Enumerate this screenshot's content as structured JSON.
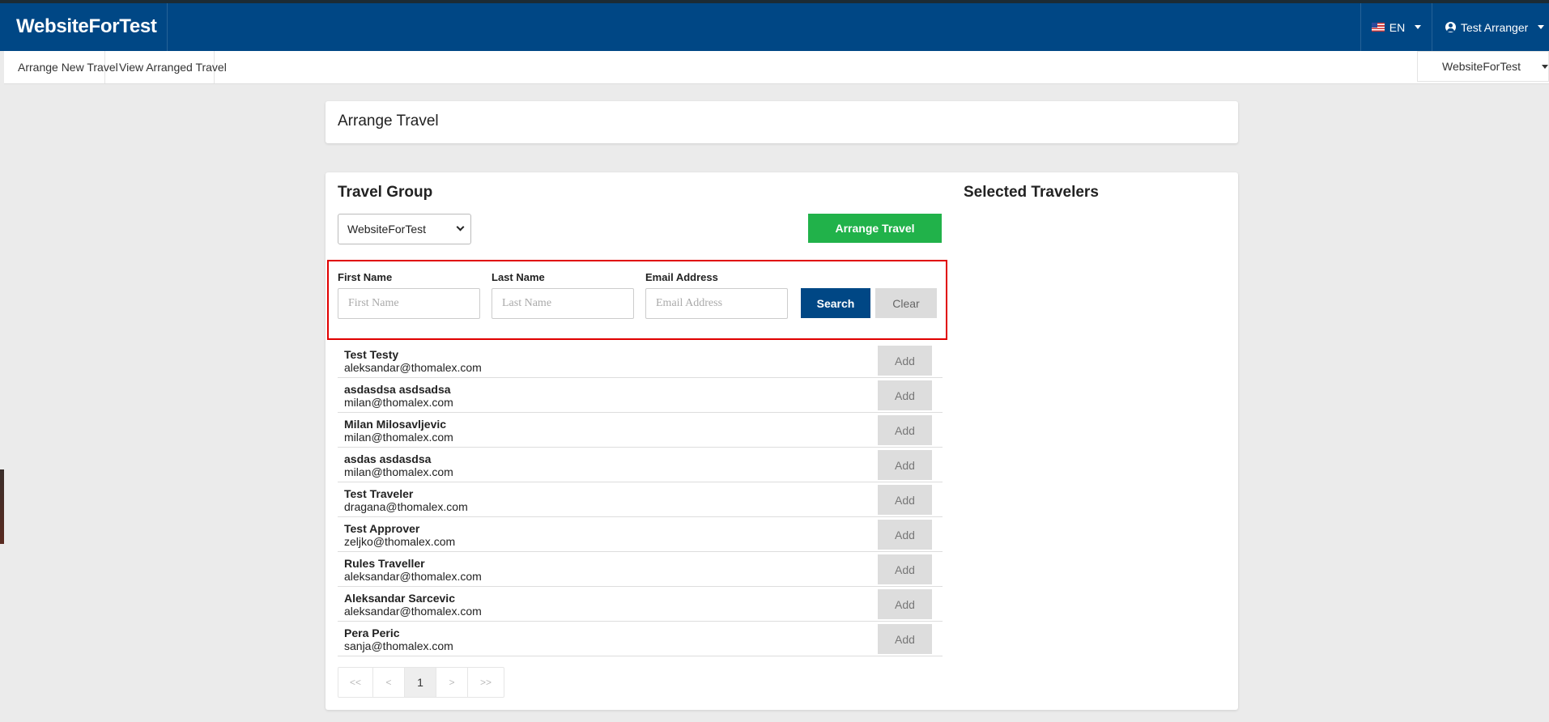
{
  "app": {
    "brand": "WebsiteForTest"
  },
  "topbar": {
    "language": "EN",
    "user": "Test Arranger"
  },
  "subnav": {
    "items": [
      "Arrange New Travel",
      "View Arranged Travel"
    ],
    "org_selector": "WebsiteForTest"
  },
  "page": {
    "title": "Arrange Travel"
  },
  "travel_group": {
    "title": "Travel Group",
    "selected_group": "WebsiteForTest",
    "arrange_button": "Arrange Travel"
  },
  "filters": {
    "first_name": {
      "label": "First Name",
      "placeholder": "First Name",
      "value": ""
    },
    "last_name": {
      "label": "Last Name",
      "placeholder": "Last Name",
      "value": ""
    },
    "email": {
      "label": "Email Address",
      "placeholder": "Email Address",
      "value": ""
    },
    "search_button": "Search",
    "clear_button": "Clear"
  },
  "travelers": [
    {
      "name": "Test Testy",
      "email": "aleksandar@thomalex.com",
      "action": "Add"
    },
    {
      "name": "asdasdsa asdsadsa",
      "email": "milan@thomalex.com",
      "action": "Add"
    },
    {
      "name": "Milan Milosavljevic",
      "email": "milan@thomalex.com",
      "action": "Add"
    },
    {
      "name": "asdas asdasdsa",
      "email": "milan@thomalex.com",
      "action": "Add"
    },
    {
      "name": "Test Traveler",
      "email": "dragana@thomalex.com",
      "action": "Add"
    },
    {
      "name": "Test Approver",
      "email": "zeljko@thomalex.com",
      "action": "Add"
    },
    {
      "name": "Rules Traveller",
      "email": "aleksandar@thomalex.com",
      "action": "Add"
    },
    {
      "name": "Aleksandar Sarcevic",
      "email": "aleksandar@thomalex.com",
      "action": "Add"
    },
    {
      "name": "Pera Peric",
      "email": "sanja@thomalex.com",
      "action": "Add"
    }
  ],
  "pagination": {
    "first": "<<",
    "prev": "<",
    "current": "1",
    "next": ">",
    "last": ">>"
  },
  "selected_travelers": {
    "title": "Selected Travelers"
  },
  "colors": {
    "header": "#004785",
    "arrange": "#21b24a",
    "search": "#004785",
    "highlight": "#e00000"
  }
}
